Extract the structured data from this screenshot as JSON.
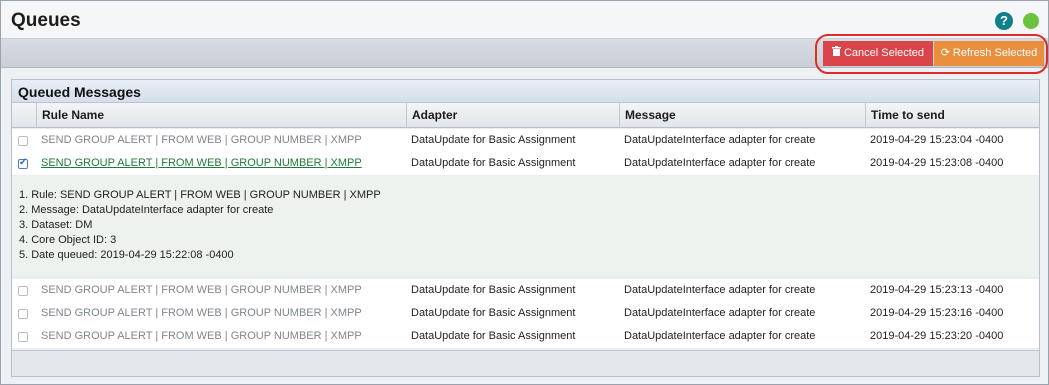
{
  "header": {
    "title": "Queues"
  },
  "toolbar": {
    "cancel_label": "Cancel Selected",
    "refresh_label": "Refresh Selected"
  },
  "panel": {
    "title": "Queued Messages"
  },
  "table": {
    "columns": [
      "Rule Name",
      "Adapter",
      "Message",
      "Time to send"
    ],
    "rows": [
      {
        "checked": false,
        "rule": "SEND GROUP ALERT | FROM WEB | GROUP NUMBER | XMPP",
        "adapter": "DataUpdate for Basic Assignment",
        "message": "DataUpdateInterface adapter for create",
        "time": "2019-04-29 15:23:04 -0400"
      },
      {
        "checked": true,
        "rule": "SEND GROUP ALERT | FROM WEB | GROUP NUMBER | XMPP",
        "adapter": "DataUpdate for Basic Assignment",
        "message": "DataUpdateInterface adapter for create",
        "time": "2019-04-29 15:23:08 -0400"
      },
      {
        "checked": false,
        "rule": "SEND GROUP ALERT | FROM WEB | GROUP NUMBER | XMPP",
        "adapter": "DataUpdate for Basic Assignment",
        "message": "DataUpdateInterface adapter for create",
        "time": "2019-04-29 15:23:13 -0400"
      },
      {
        "checked": false,
        "rule": "SEND GROUP ALERT | FROM WEB | GROUP NUMBER | XMPP",
        "adapter": "DataUpdate for Basic Assignment",
        "message": "DataUpdateInterface adapter for create",
        "time": "2019-04-29 15:23:16 -0400"
      },
      {
        "checked": false,
        "rule": "SEND GROUP ALERT | FROM WEB | GROUP NUMBER | XMPP",
        "adapter": "DataUpdate for Basic Assignment",
        "message": "DataUpdateInterface adapter for create",
        "time": "2019-04-29 15:23:20 -0400"
      }
    ],
    "details": [
      "1. Rule: SEND GROUP ALERT | FROM WEB | GROUP NUMBER | XMPP",
      "2. Message: DataUpdateInterface adapter for create",
      "3. Dataset: DM",
      "4. Core Object ID: 3",
      "5. Date queued: 2019-04-29 15:22:08 -0400"
    ]
  },
  "icons": {
    "help": "question-circle-icon",
    "status": "status-dot-icon",
    "cancel": "trash-icon",
    "refresh": "refresh-icon"
  },
  "colors": {
    "cancel_button": "#d9454a",
    "refresh_button": "#e98f3e",
    "help_icon": "#0f7f8a",
    "status_ok": "#6cc13d",
    "link_rule": "#1e7b38",
    "annotation_circle": "#e22a2a"
  }
}
